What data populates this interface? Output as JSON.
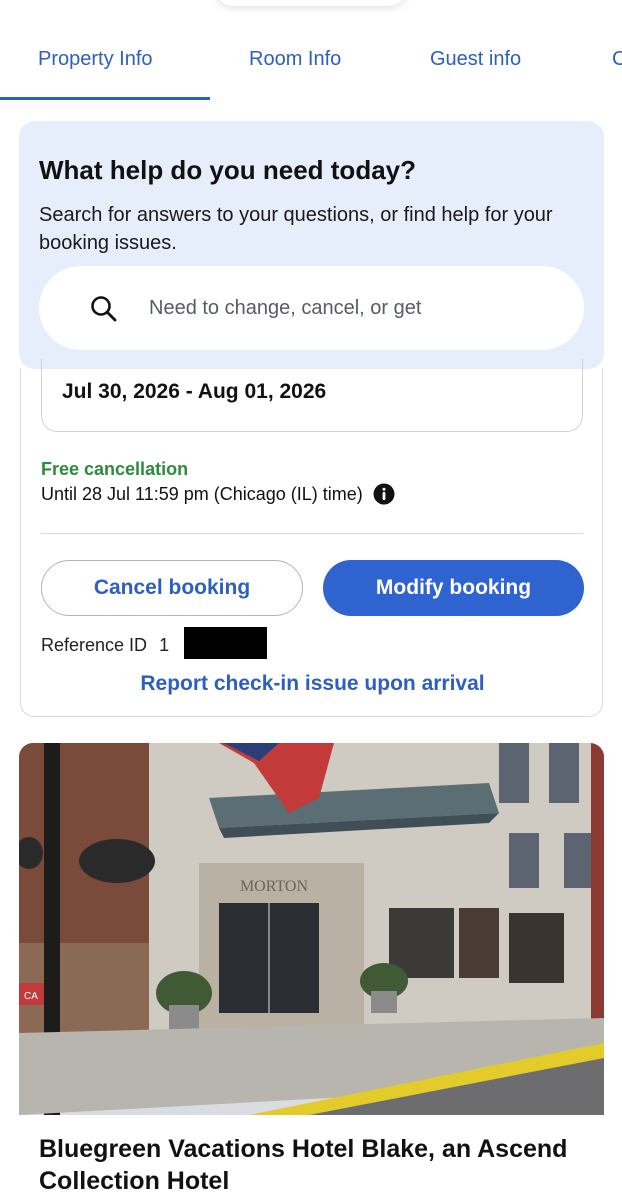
{
  "tabs": [
    {
      "label": "Property Info"
    },
    {
      "label": "Room Info"
    },
    {
      "label": "Guest info"
    },
    {
      "label": "C"
    }
  ],
  "active_tab": "Property Info",
  "help": {
    "title": "What help do you need today?",
    "description": "Search for answers to your questions, or find help for your booking issues.",
    "search_placeholder": "Need to change, cancel, or get"
  },
  "booking": {
    "dates": "Jul 30, 2026 - Aug 01, 2026",
    "free_cancellation_label": "Free cancellation",
    "until_text": "Until 28 Jul 11:59 pm (Chicago (IL) time)",
    "cancel_button": "Cancel booking",
    "modify_button": "Modify booking",
    "reference_label": "Reference ID",
    "reference_value": "1",
    "report_link": "Report check-in issue upon arrival"
  },
  "hotel": {
    "name": "Bluegreen Vacations Hotel Blake, an Ascend Collection Hotel",
    "building_sign": "MORTON",
    "street_sign": "CA"
  },
  "colors": {
    "accent": "#2d5fbf",
    "primary_button": "#2f63d0",
    "help_background": "#e6edfb",
    "success": "#2e8a3c"
  }
}
